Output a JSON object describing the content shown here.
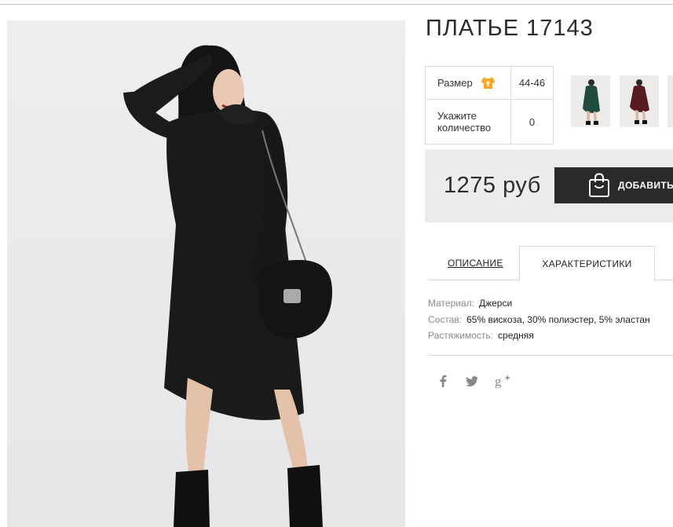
{
  "product": {
    "title": "ПЛАТЬЕ 17143",
    "image_alt": "product-photo"
  },
  "options": {
    "size_label": "Размер",
    "size_value": "44-46",
    "quantity_label": "Укажите количество",
    "quantity_value": "0"
  },
  "thumbnails": [
    {
      "color_name": "green",
      "color": "#1f4a3e"
    },
    {
      "color_name": "burgundy",
      "color": "#5a1a24"
    },
    {
      "color_name": "partial",
      "color": "#dddddd"
    }
  ],
  "purchase": {
    "price": "1275 руб",
    "add_button_label": "ДОБАВИТЬ"
  },
  "tabs": {
    "description": "ОПИСАНИЕ",
    "characteristics": "ХАРАКТЕРИСТИКИ"
  },
  "specs": [
    {
      "key": "Материал:",
      "value": "Джерси"
    },
    {
      "key": "Состав:",
      "value": "65% вискоза, 30% полиэстер, 5% эластан"
    },
    {
      "key": "Растяжимость:",
      "value": "средняя"
    }
  ],
  "social": [
    {
      "name": "facebook-icon",
      "glyph": "f"
    },
    {
      "name": "twitter-icon",
      "glyph": "t"
    },
    {
      "name": "google-plus-icon",
      "glyph": "g+"
    }
  ],
  "colors": {
    "accent_orange": "#f5a623",
    "button_dark": "#2a2a2a",
    "price_box": "#ececec"
  }
}
